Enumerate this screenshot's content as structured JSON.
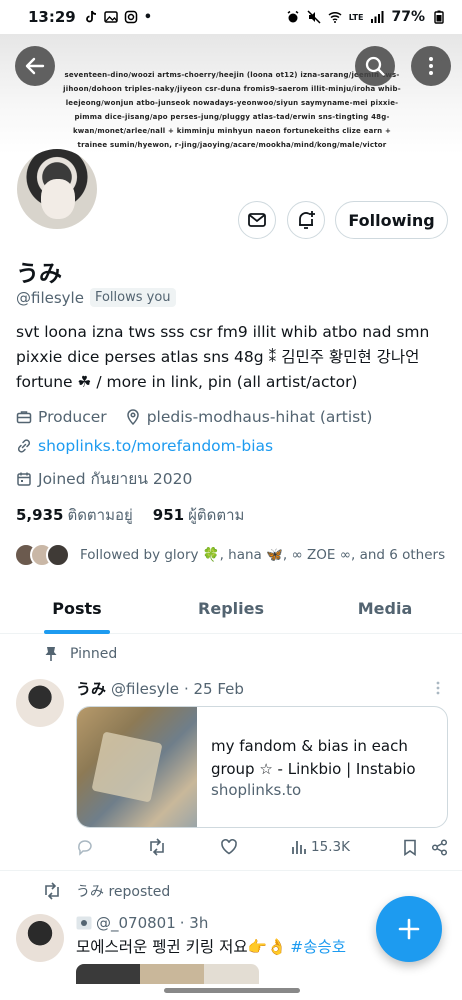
{
  "status_bar": {
    "time": "13:29",
    "battery": "77%",
    "network": "LTE"
  },
  "banner": {
    "text": "seventeen-dino/woozi artms-choerry/heejin (loona ot12) izna-sarang/jeemin tws-jihoon/dohoon triples-naky/jiyeon csr-duna fromis9-saerom illit-minju/iroha whib-leejeong/wonjun atbo-junseok nowadays-yeonwoo/siyun saymyname-mei pixxie-pimma dice-jisang/apo perses-jung/pluggy atlas-tad/erwin sns-tingting 48g-kwan/monet/arlee/nall + kimminju minhyun naeon fortunekeiths clize earn + trainee sumin/hyewon, r-jing/jaoying/acare/mookha/mind/kong/male/victor"
  },
  "profile": {
    "name": "うみ",
    "handle": "@filesyle",
    "follows_you": "Follows you",
    "follow_button": "Following",
    "bio": "svt loona izna tws sss csr fm9 illit whib atbo nad smn pixxie dice perses atlas sns 48g ⁑ 김민주 황민현 강나언 fortune ☘ / more in link, pin (all artist/actor)",
    "category": "Producer",
    "location": "pledis-modhaus-hihat (artist)",
    "link": "shoplinks.to/morefandom-bias",
    "joined": "Joined กันยายน 2020",
    "following_count": "5,935",
    "following_label": "ติดตามอยู่",
    "followers_count": "951",
    "followers_label": "ผู้ติดตาม",
    "followed_by": "Followed by glory 🍀, hana 🦋, ∞ ZOE ∞, and 6 others"
  },
  "tabs": [
    "Posts",
    "Replies",
    "Media"
  ],
  "pinned_post": {
    "pinned_label": "Pinned",
    "author_name": "うみ",
    "author_handle": "@filesyle",
    "date": "· 25 Feb",
    "card_title": "my fandom & bias in each group ☆ - Linkbio | Instabio",
    "card_url": "shoplinks.to",
    "views": "15.3K"
  },
  "repost": {
    "repost_label": "うみ reposted",
    "handle": "@_070801",
    "time": "· 3h",
    "text": "모에스러운 펭귄 키링 저요👉👌",
    "hashtag": "#송승호"
  },
  "colors": {
    "accent": "#1d9bf0",
    "text_primary": "#0f1419",
    "text_secondary": "#536471"
  }
}
